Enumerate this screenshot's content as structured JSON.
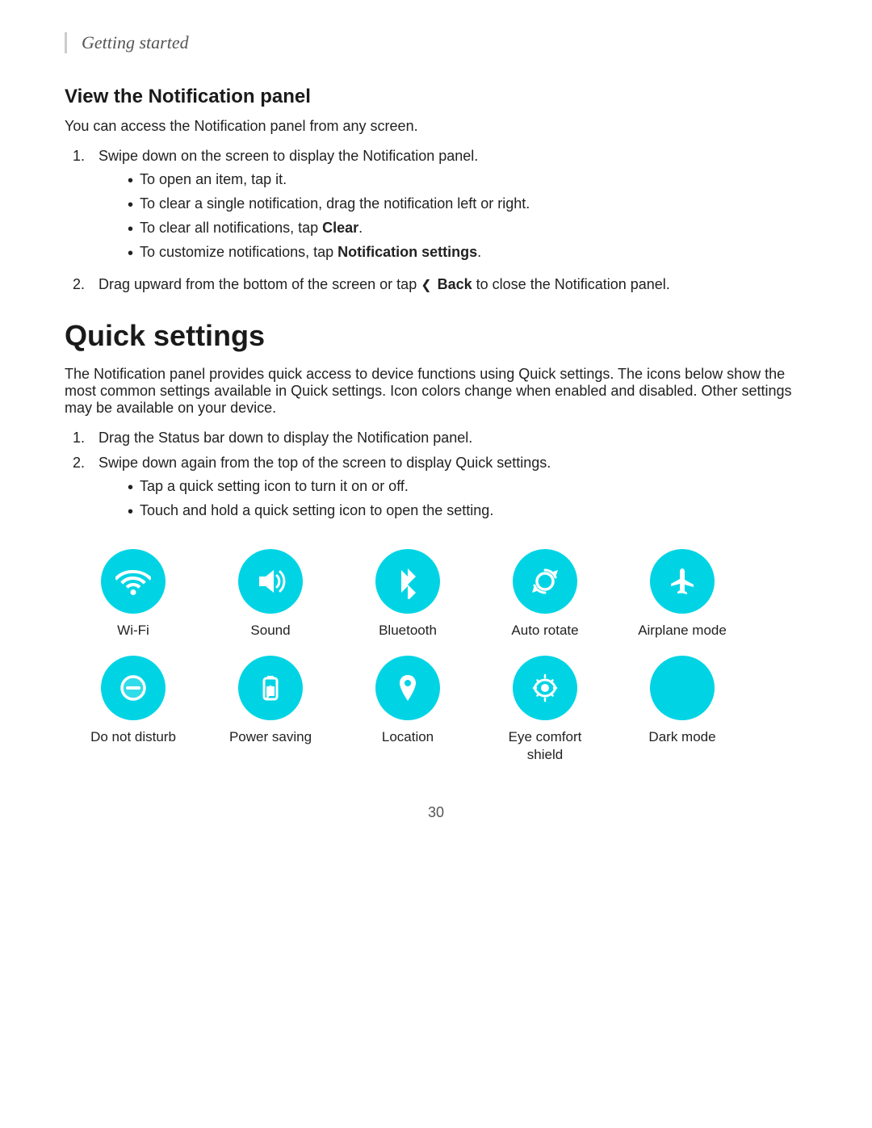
{
  "header": {
    "text": "Getting started"
  },
  "notification_section": {
    "title": "View the Notification panel",
    "intro": "You can access the Notification panel from any screen.",
    "steps": [
      {
        "text": "Swipe down on the screen to display the Notification panel.",
        "bullets": [
          "To open an item, tap it.",
          "To clear a single notification, drag the notification left or right.",
          "To clear all notifications, tap <b>Clear</b>.",
          "To customize notifications, tap <b>Notification settings</b>."
        ]
      },
      {
        "text": "Drag upward from the bottom of the screen or tap ‹ <b>Back</b> to close the Notification panel.",
        "bullets": []
      }
    ]
  },
  "quick_settings_section": {
    "title": "Quick settings",
    "intro": "The Notification panel provides quick access to device functions using Quick settings. The icons below show the most common settings available in Quick settings. Icon colors change when enabled and disabled. Other settings may be available on your device.",
    "steps": [
      {
        "text": "Drag the Status bar down to display the Notification panel.",
        "bullets": []
      },
      {
        "text": "Swipe down again from the top of the screen to display Quick settings.",
        "bullets": [
          "Tap a quick setting icon to turn it on or off.",
          "Touch and hold a quick setting icon to open the setting."
        ]
      }
    ],
    "icons_row1": [
      {
        "id": "wifi",
        "label": "Wi-Fi"
      },
      {
        "id": "sound",
        "label": "Sound"
      },
      {
        "id": "bluetooth",
        "label": "Bluetooth"
      },
      {
        "id": "autorotate",
        "label": "Auto rotate"
      },
      {
        "id": "airplane",
        "label": "Airplane mode"
      }
    ],
    "icons_row2": [
      {
        "id": "donotdisturb",
        "label": "Do not disturb"
      },
      {
        "id": "powersaving",
        "label": "Power saving"
      },
      {
        "id": "location",
        "label": "Location"
      },
      {
        "id": "eyecomfort",
        "label": "Eye comfort\nshield"
      },
      {
        "id": "darkmode",
        "label": "Dark mode"
      }
    ]
  },
  "page_number": "30"
}
